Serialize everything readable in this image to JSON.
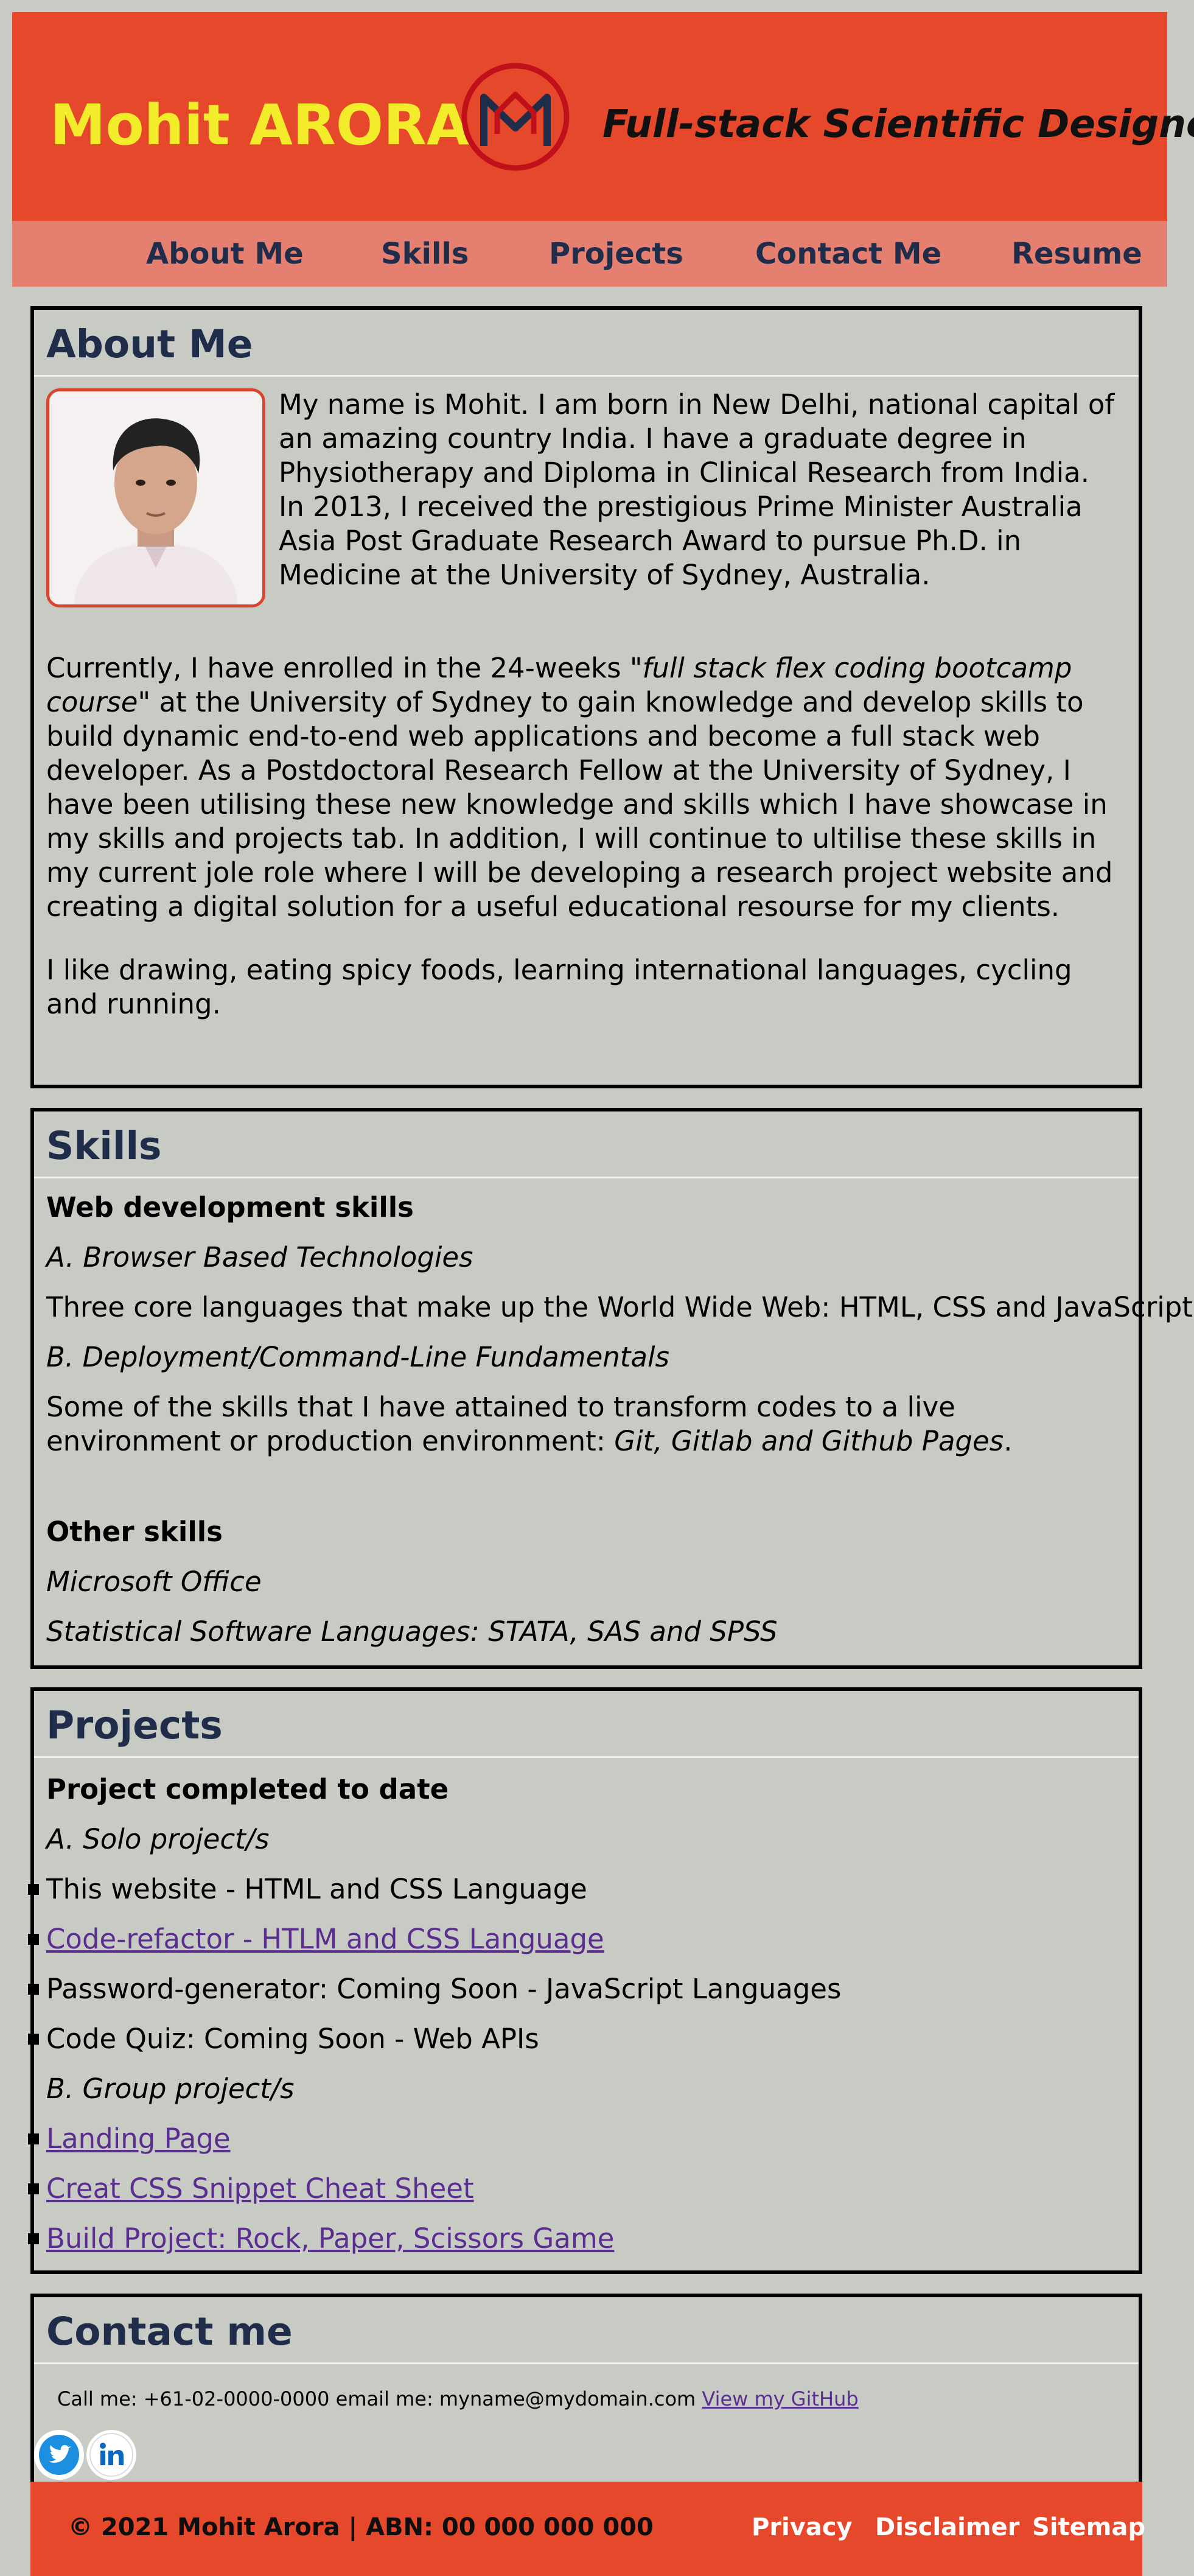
{
  "header": {
    "site_name": "Mohit ARORA",
    "logo_letters": "M",
    "tagline": "Full-stack Scientific Designer",
    "colors": {
      "background": "#e6482b",
      "name": "#f3ec2b",
      "nav": "#e58070"
    }
  },
  "nav": {
    "items": [
      {
        "label": "About Me"
      },
      {
        "label": "Skills"
      },
      {
        "label": "Projects"
      },
      {
        "label": "Contact Me"
      },
      {
        "label": "Resume"
      }
    ]
  },
  "about": {
    "heading": "About Me",
    "p1": "My name is Mohit. I am born in New Delhi, national capital of an amazing country India. I have a graduate degree in Physiotherapy and Diploma in Clinical Research from India. In 2013, I received the prestigious Prime Minister Australia Asia Post Graduate Research Award to pursue Ph.D. in Medicine at the University of Sydney, Australia.",
    "p2_before": "Currently, I have enrolled in the 24-weeks \"",
    "p2_italic": "full stack flex coding bootcamp course",
    "p2_after": "\" at the University of Sydney to gain knowledge and develop skills to build dynamic end-to-end web applications and become a full stack web developer. As a Postdoctoral Research Fellow at the University of Sydney, I have been utilising these new knowledge and skills which I have showcase in my skills and projects tab. In addition, I will continue to ultilise these skills in my current jole role where I will be developing a research project website and creating a digital solution for a useful educational resourse for my clients.",
    "p3": "I like drawing, eating spicy foods, learning international languages, cycling and running."
  },
  "skills": {
    "heading": "Skills",
    "web_heading": "Web development skills",
    "a_title": "A. Browser Based Technologies",
    "a_text": "Three core languages that make up the World Wide Web: HTML, CSS and JavaScript.",
    "b_title": "B. Deployment/Command-Line Fundamentals",
    "b_text": "Some of the skills that I have attained to transform codes to a live environment or production environment: ",
    "b_text_italic": "Git, Gitlab and Github Pages",
    "b_text_end": ".",
    "other_heading": "Other skills",
    "other_1": "Microsoft Office",
    "other_2": "Statistical Software Languages: STATA, SAS and SPSS"
  },
  "projects": {
    "heading": "Projects",
    "subheading": "Project completed to date",
    "solo_title": "A. Solo project/s",
    "solo_items": [
      {
        "label": "This website - HTML and CSS Language",
        "link": false
      },
      {
        "label": "Code-refactor - HTLM and CSS Language",
        "link": true
      },
      {
        "label": "Password-generator: Coming Soon - JavaScript Languages",
        "link": false
      },
      {
        "label": "Code Quiz: Coming Soon - Web APIs",
        "link": false
      }
    ],
    "group_title": "B. Group project/s",
    "group_items": [
      {
        "label": "Landing Page",
        "link": true
      },
      {
        "label": "Creat CSS Snippet Cheat Sheet",
        "link": true
      },
      {
        "label": "Build Project: Rock, Paper, Scissors Game",
        "link": true
      }
    ]
  },
  "contact": {
    "heading": "Contact me",
    "text": "Call me: +61-02-0000-0000 email me: myname@mydomain.com ",
    "github_link": "View my GitHub",
    "social": [
      {
        "icon": "twitter-icon"
      },
      {
        "icon": "linkedin-icon"
      }
    ]
  },
  "footer": {
    "copyright": "© 2021 Mohit Arora | ABN: 00 000 000 000",
    "links": [
      {
        "label": "Privacy"
      },
      {
        "label": "Disclaimer"
      },
      {
        "label": "Sitemap"
      }
    ]
  }
}
